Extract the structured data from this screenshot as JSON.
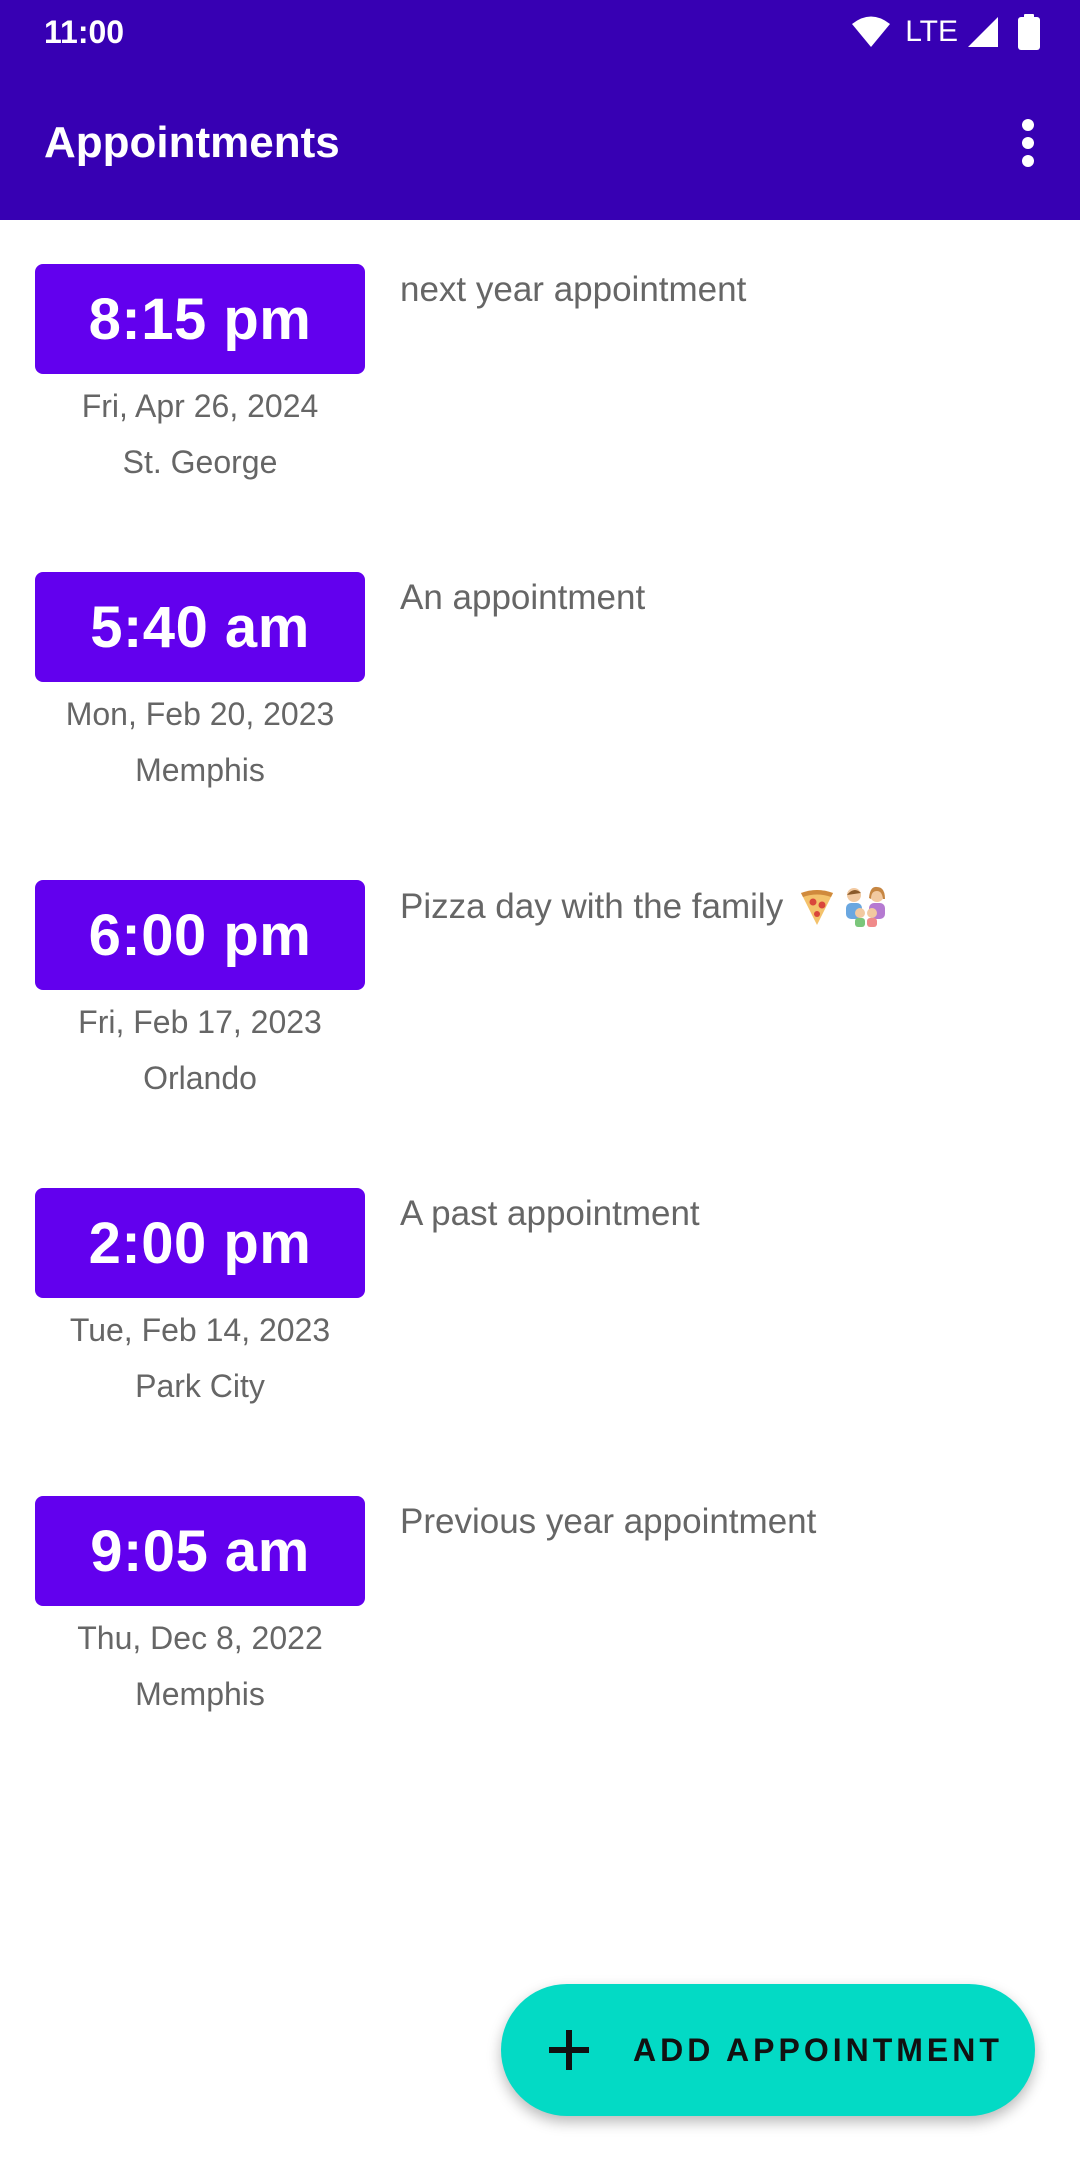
{
  "status_bar": {
    "time": "11:00",
    "network": "LTE",
    "icons": [
      "wifi-icon",
      "signal-icon",
      "battery-icon"
    ]
  },
  "toolbar": {
    "title": "Appointments",
    "menu_icon": "more-vert-icon"
  },
  "appointments": [
    {
      "time": "8:15 pm",
      "date": "Fri, Apr 26, 2024",
      "location": "St. George",
      "description": "next year appointment"
    },
    {
      "time": "5:40 am",
      "date": "Mon, Feb 20, 2023",
      "location": "Memphis",
      "description": "An appointment"
    },
    {
      "time": "6:00 pm",
      "date": "Fri, Feb 17, 2023",
      "location": "Orlando",
      "description": "Pizza day with the family",
      "emojis": [
        "pizza-icon",
        "family-icon"
      ]
    },
    {
      "time": "2:00 pm",
      "date": "Tue, Feb 14, 2023",
      "location": "Park City",
      "description": "A past appointment"
    },
    {
      "time": "9:05 am",
      "date": "Thu, Dec 8, 2022",
      "location": "Memphis",
      "description": "Previous year appointment"
    }
  ],
  "fab": {
    "label": "ADD APPOINTMENT",
    "icon": "plus-icon"
  },
  "colors": {
    "app_bar": "#3700b3",
    "time_badge": "#6200ee",
    "fab": "#03dac5",
    "secondary_text": "#666666"
  }
}
